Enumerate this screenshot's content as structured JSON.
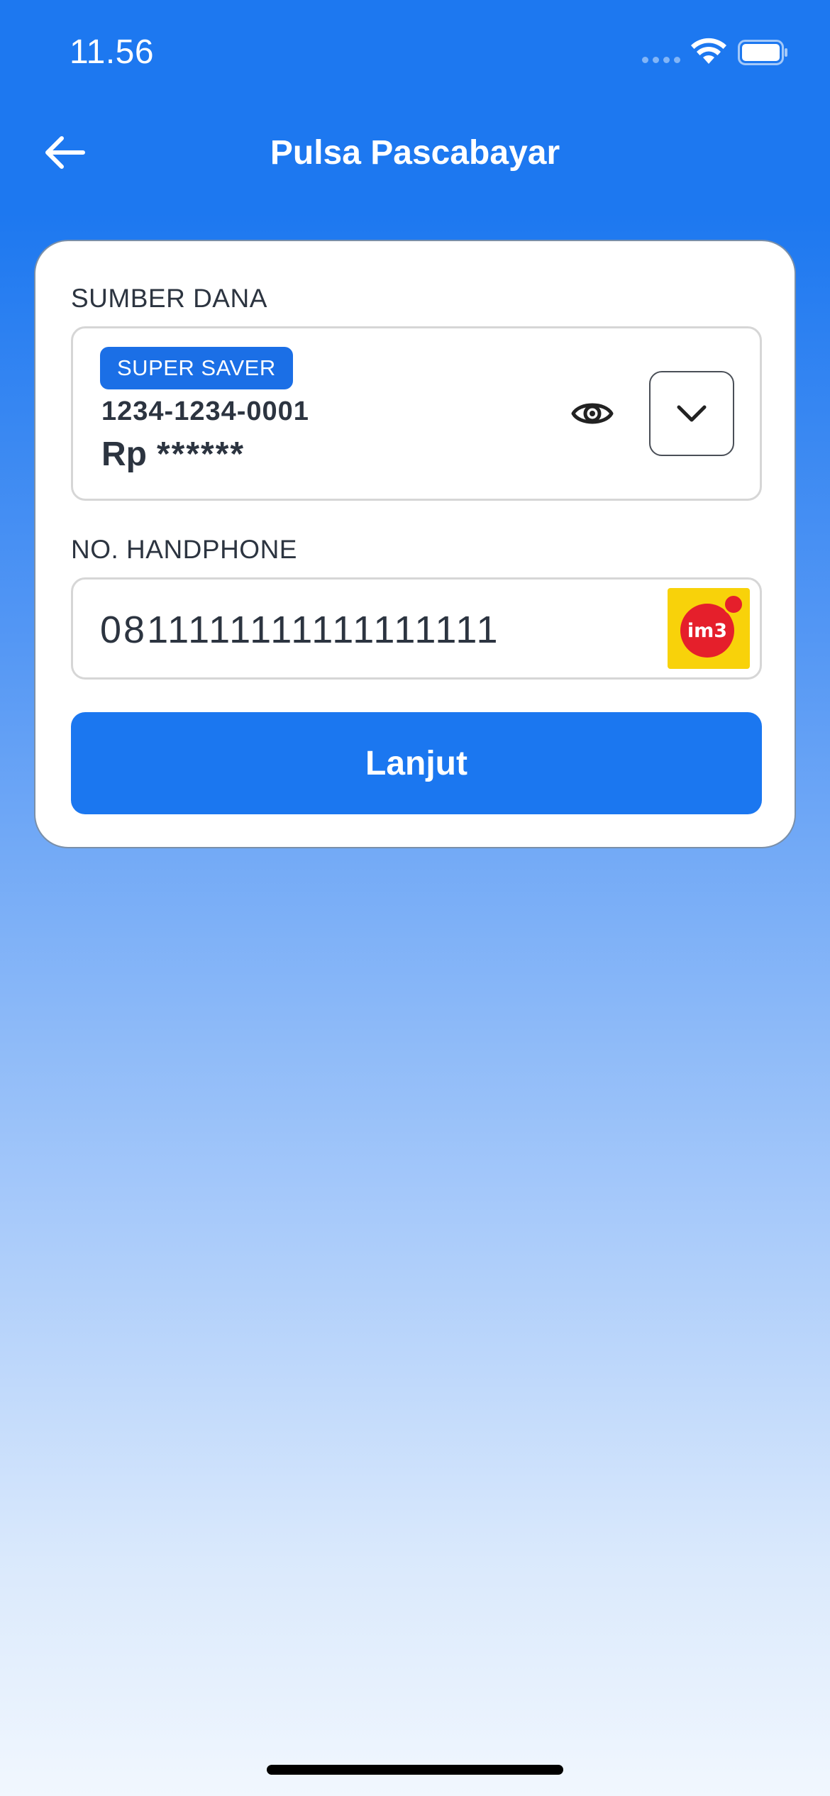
{
  "status_bar": {
    "time": "11.56",
    "icons": [
      "signal-dots-icon",
      "wifi-icon",
      "battery-icon"
    ]
  },
  "header": {
    "back_icon": "arrow-left-icon",
    "title": "Pulsa Pascabayar"
  },
  "form": {
    "source_label": "SUMBER DANA",
    "source": {
      "badge": "SUPER SAVER",
      "account_number": "1234-1234-0001",
      "balance_currency": "Rp",
      "balance_masked": "******",
      "eye_icon": "eye-icon",
      "dropdown_icon": "chevron-down-icon"
    },
    "phone_label": "NO. HANDPHONE",
    "phone": {
      "value": "0811111111111111111",
      "provider_logo_text": "im3",
      "provider_logo_icon": "im3-logo-icon"
    },
    "submit_label": "Lanjut"
  },
  "colors": {
    "primary": "#1b77f0",
    "badge": "#1b6fe6",
    "text_dark": "#2c3440",
    "provider_yellow": "#f8d20a",
    "provider_red": "#e51f2b"
  }
}
